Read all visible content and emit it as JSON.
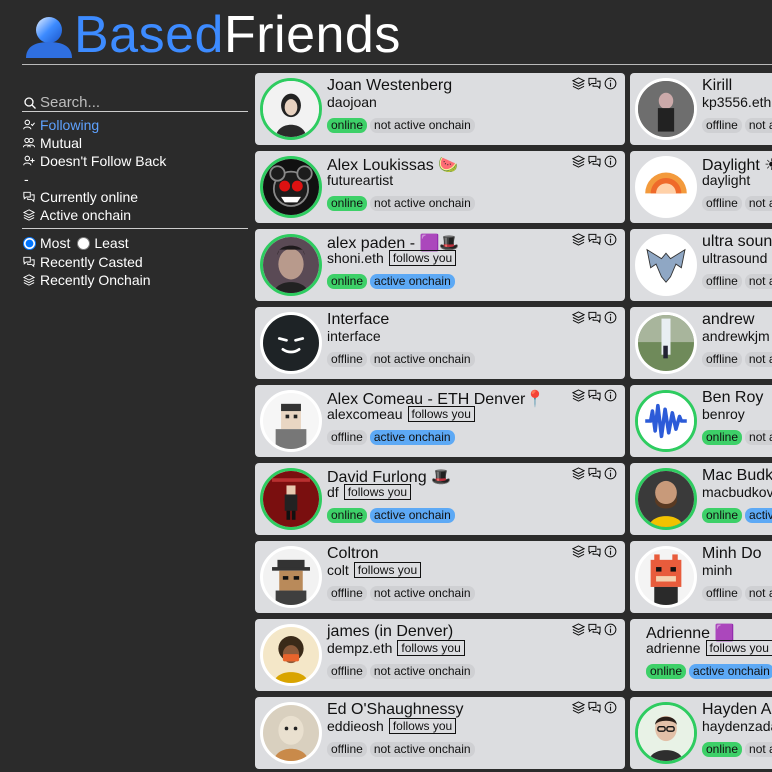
{
  "header": {
    "title_part1": "Based",
    "title_part2": "Friends",
    "logo": "user-logo-icon"
  },
  "sidebar": {
    "search_placeholder": "Search...",
    "nav": [
      {
        "label": "Following",
        "icon": "user-check-icon",
        "active": true
      },
      {
        "label": "Mutual",
        "icon": "users-icon",
        "active": false
      },
      {
        "label": "Doesn't Follow Back",
        "icon": "user-plus-icon",
        "active": false
      }
    ],
    "dash": "-",
    "filters": [
      {
        "label": "Currently online",
        "icon": "chat-icon"
      },
      {
        "label": "Active onchain",
        "icon": "layers-icon"
      }
    ],
    "sort": {
      "most": "Most",
      "least": "Least",
      "selected": "Most"
    },
    "sort_options": [
      {
        "label": "Recently Casted",
        "icon": "chat-icon"
      },
      {
        "label": "Recently Onchain",
        "icon": "layers-icon"
      }
    ]
  },
  "labels": {
    "follows_you": "follows you",
    "online": "online",
    "offline": "offline",
    "active_onchain": "active onchain",
    "not_active_onchain": "not active onchain"
  },
  "cards_col1": [
    {
      "name": "Joan Westenberg",
      "username": "daojoan",
      "follows_you": false,
      "online": true,
      "active": false
    },
    {
      "name": "Alex Loukissas 🍉",
      "username": "futureartist",
      "follows_you": false,
      "online": true,
      "active": false
    },
    {
      "name": "alex paden - 🟪🎩",
      "username": "shoni.eth",
      "follows_you": true,
      "online": true,
      "active": true
    },
    {
      "name": "Interface",
      "username": "interface",
      "follows_you": false,
      "online": false,
      "active": false
    },
    {
      "name": "Alex Comeau - ETH Denver📍",
      "username": "alexcomeau",
      "follows_you": true,
      "online": false,
      "active": true
    },
    {
      "name": "David Furlong 🎩",
      "username": "df",
      "follows_you": true,
      "online": true,
      "active": true
    },
    {
      "name": "Coltron",
      "username": "colt",
      "follows_you": true,
      "online": false,
      "active": false
    },
    {
      "name": "james (in Denver)",
      "username": "dempz.eth",
      "follows_you": true,
      "online": false,
      "active": false
    },
    {
      "name": "Ed O'Shaughnessy",
      "username": "eddieosh",
      "follows_you": true,
      "online": false,
      "active": false
    }
  ],
  "cards_col2": [
    {
      "name": "Kirill",
      "username": "kp3556.eth",
      "follows_you": false,
      "online": false,
      "active": false
    },
    {
      "name": "Daylight ☀",
      "username": "daylight",
      "follows_you": false,
      "online": false,
      "active": false
    },
    {
      "name": "ultra sound",
      "username": "ultrasound",
      "follows_you": false,
      "online": false,
      "active": false
    },
    {
      "name": "andrew",
      "username": "andrewkjm",
      "follows_you": false,
      "online": false,
      "active": false
    },
    {
      "name": "Ben Roy",
      "username": "benroy",
      "follows_you": false,
      "online": true,
      "active": false
    },
    {
      "name": "Mac Budk",
      "username": "macbudkov",
      "follows_you": false,
      "online": true,
      "active": true
    },
    {
      "name": "Minh Do",
      "username": "minh",
      "follows_you": false,
      "online": false,
      "active": false
    },
    {
      "name": "Adrienne 🟪",
      "username": "adrienne",
      "follows_you": true,
      "online": true,
      "active": true
    },
    {
      "name": "Hayden Ad",
      "username": "haydenzada",
      "follows_you": false,
      "online": true,
      "active": false
    }
  ]
}
